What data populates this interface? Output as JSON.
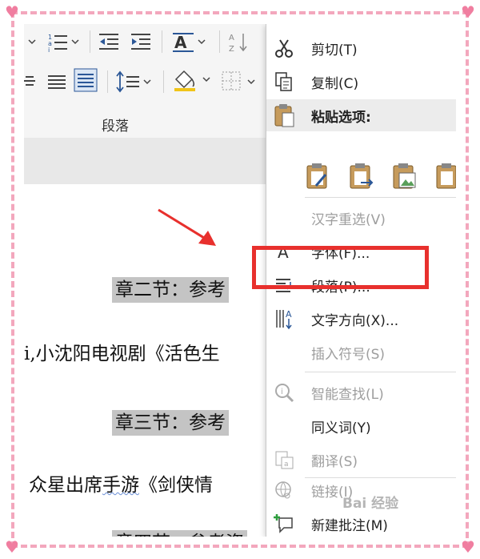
{
  "ribbon": {
    "group_label": "段落"
  },
  "document": {
    "lines": [
      {
        "text": "章二节：参考",
        "highlight": true
      },
      {
        "text": "i,小沈阳电视剧《活色生",
        "highlight": false
      },
      {
        "text": "章三节：参考",
        "highlight": true
      },
      {
        "text_before": "众星出席",
        "text_wavy": "手游",
        "text_after": "《剑侠情",
        "highlight": false
      },
      {
        "text": "章四节：参考资",
        "highlight": true
      }
    ]
  },
  "context_menu": {
    "items": [
      {
        "label": "剪切(T)",
        "icon": "scissors-icon",
        "enabled": true
      },
      {
        "label": "复制(C)",
        "icon": "copy-icon",
        "enabled": true
      },
      {
        "label": "粘贴选项:",
        "icon": "clipboard-icon",
        "enabled": true,
        "header": true
      },
      {
        "label": "汉字重选(V)",
        "icon": "",
        "enabled": false
      },
      {
        "label": "字体(F)...",
        "icon": "font-a-icon",
        "enabled": true
      },
      {
        "label": "段落(P)...",
        "icon": "paragraph-icon",
        "enabled": true
      },
      {
        "label": "文字方向(X)...",
        "icon": "text-direction-icon",
        "enabled": true
      },
      {
        "label": "插入符号(S)",
        "icon": "",
        "enabled": false
      },
      {
        "label": "智能查找(L)",
        "icon": "smart-lookup-icon",
        "enabled": false
      },
      {
        "label": "同义词(Y)",
        "icon": "",
        "enabled": true
      },
      {
        "label": "翻译(S)",
        "icon": "translate-icon",
        "enabled": false
      },
      {
        "label": "链接(I)",
        "icon": "link-icon",
        "enabled": false
      },
      {
        "label": "新建批注(M)",
        "icon": "new-comment-icon",
        "enabled": true
      }
    ],
    "paste_options": [
      "keep-source-formatting-icon",
      "merge-formatting-icon",
      "picture-paste-icon",
      "keep-text-only-icon"
    ]
  },
  "watermark": "Bai 经验",
  "colors": {
    "highlight_box": "#e8302d",
    "frame": "#f3a7bd",
    "doc_highlight": "#c4c4c4"
  }
}
